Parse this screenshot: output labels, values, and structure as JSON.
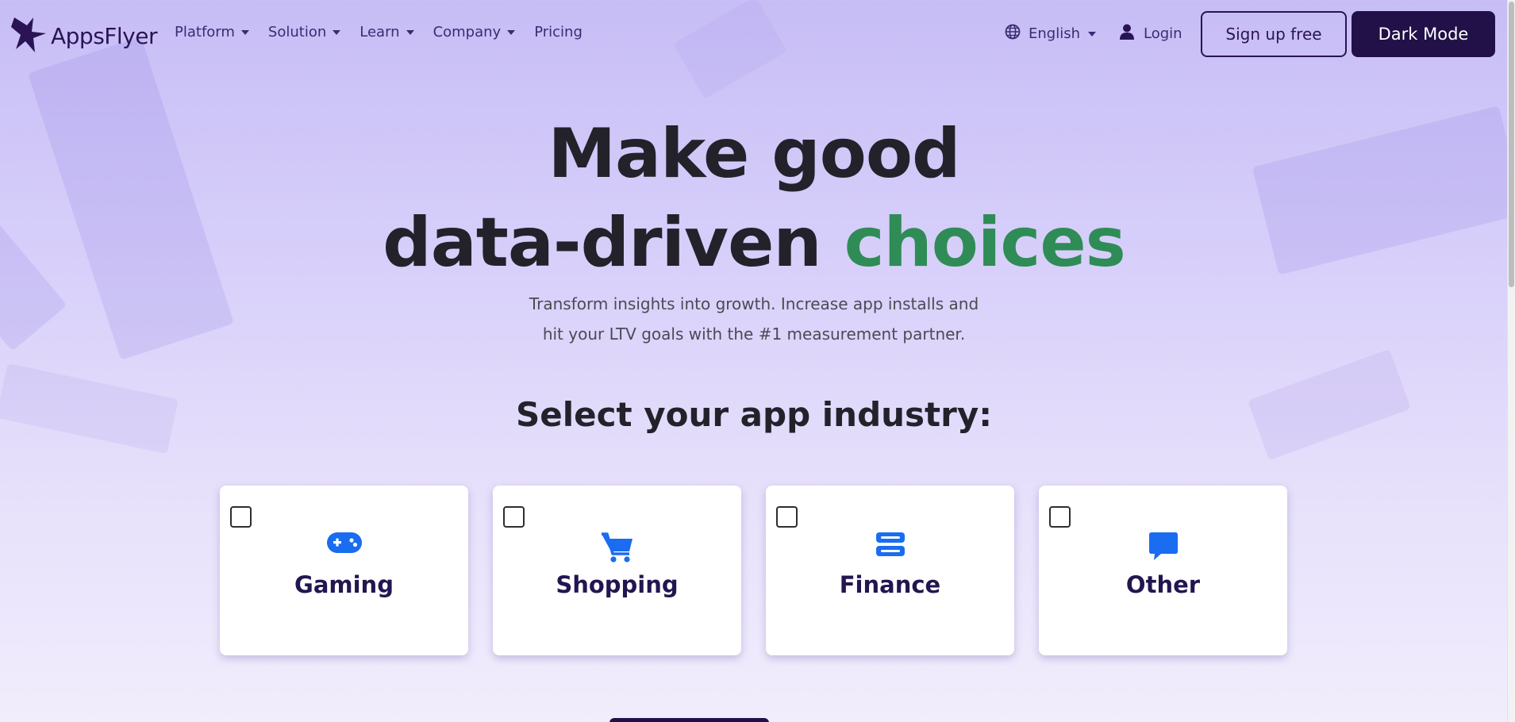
{
  "brand": {
    "name": "AppsFlyer",
    "logo_icon": "appsflyer-logo-icon"
  },
  "nav": {
    "items": [
      {
        "label": "Platform",
        "has_dropdown": true
      },
      {
        "label": "Solution",
        "has_dropdown": true
      },
      {
        "label": "Learn",
        "has_dropdown": true
      },
      {
        "label": "Company",
        "has_dropdown": true
      },
      {
        "label": "Pricing",
        "has_dropdown": false
      }
    ],
    "language": {
      "label": "English",
      "icon": "globe-icon"
    },
    "login": {
      "label": "Login",
      "icon": "user-icon"
    },
    "signup_label": "Sign up free",
    "dark_mode_label": "Dark Mode"
  },
  "hero": {
    "title_line1": "Make good",
    "title_line2_plain": "data-driven ",
    "title_line2_accent": "choices",
    "subtitle_line1": "Transform insights into growth. Increase app installs and",
    "subtitle_line2": "hit your LTV goals with the #1 measurement partner."
  },
  "industry": {
    "heading": "Select your app industry:",
    "options": [
      {
        "label": "Gaming",
        "icon": "gamepad-icon",
        "checked": false
      },
      {
        "label": "Shopping",
        "icon": "cart-icon",
        "checked": false
      },
      {
        "label": "Finance",
        "icon": "server-icon",
        "checked": false
      },
      {
        "label": "Other",
        "icon": "chat-icon",
        "checked": false
      }
    ]
  },
  "colors": {
    "brand_dark": "#221048",
    "accent_green": "#2f8c56",
    "icon_blue": "#1a6cf0",
    "text_dark": "#23222b"
  }
}
